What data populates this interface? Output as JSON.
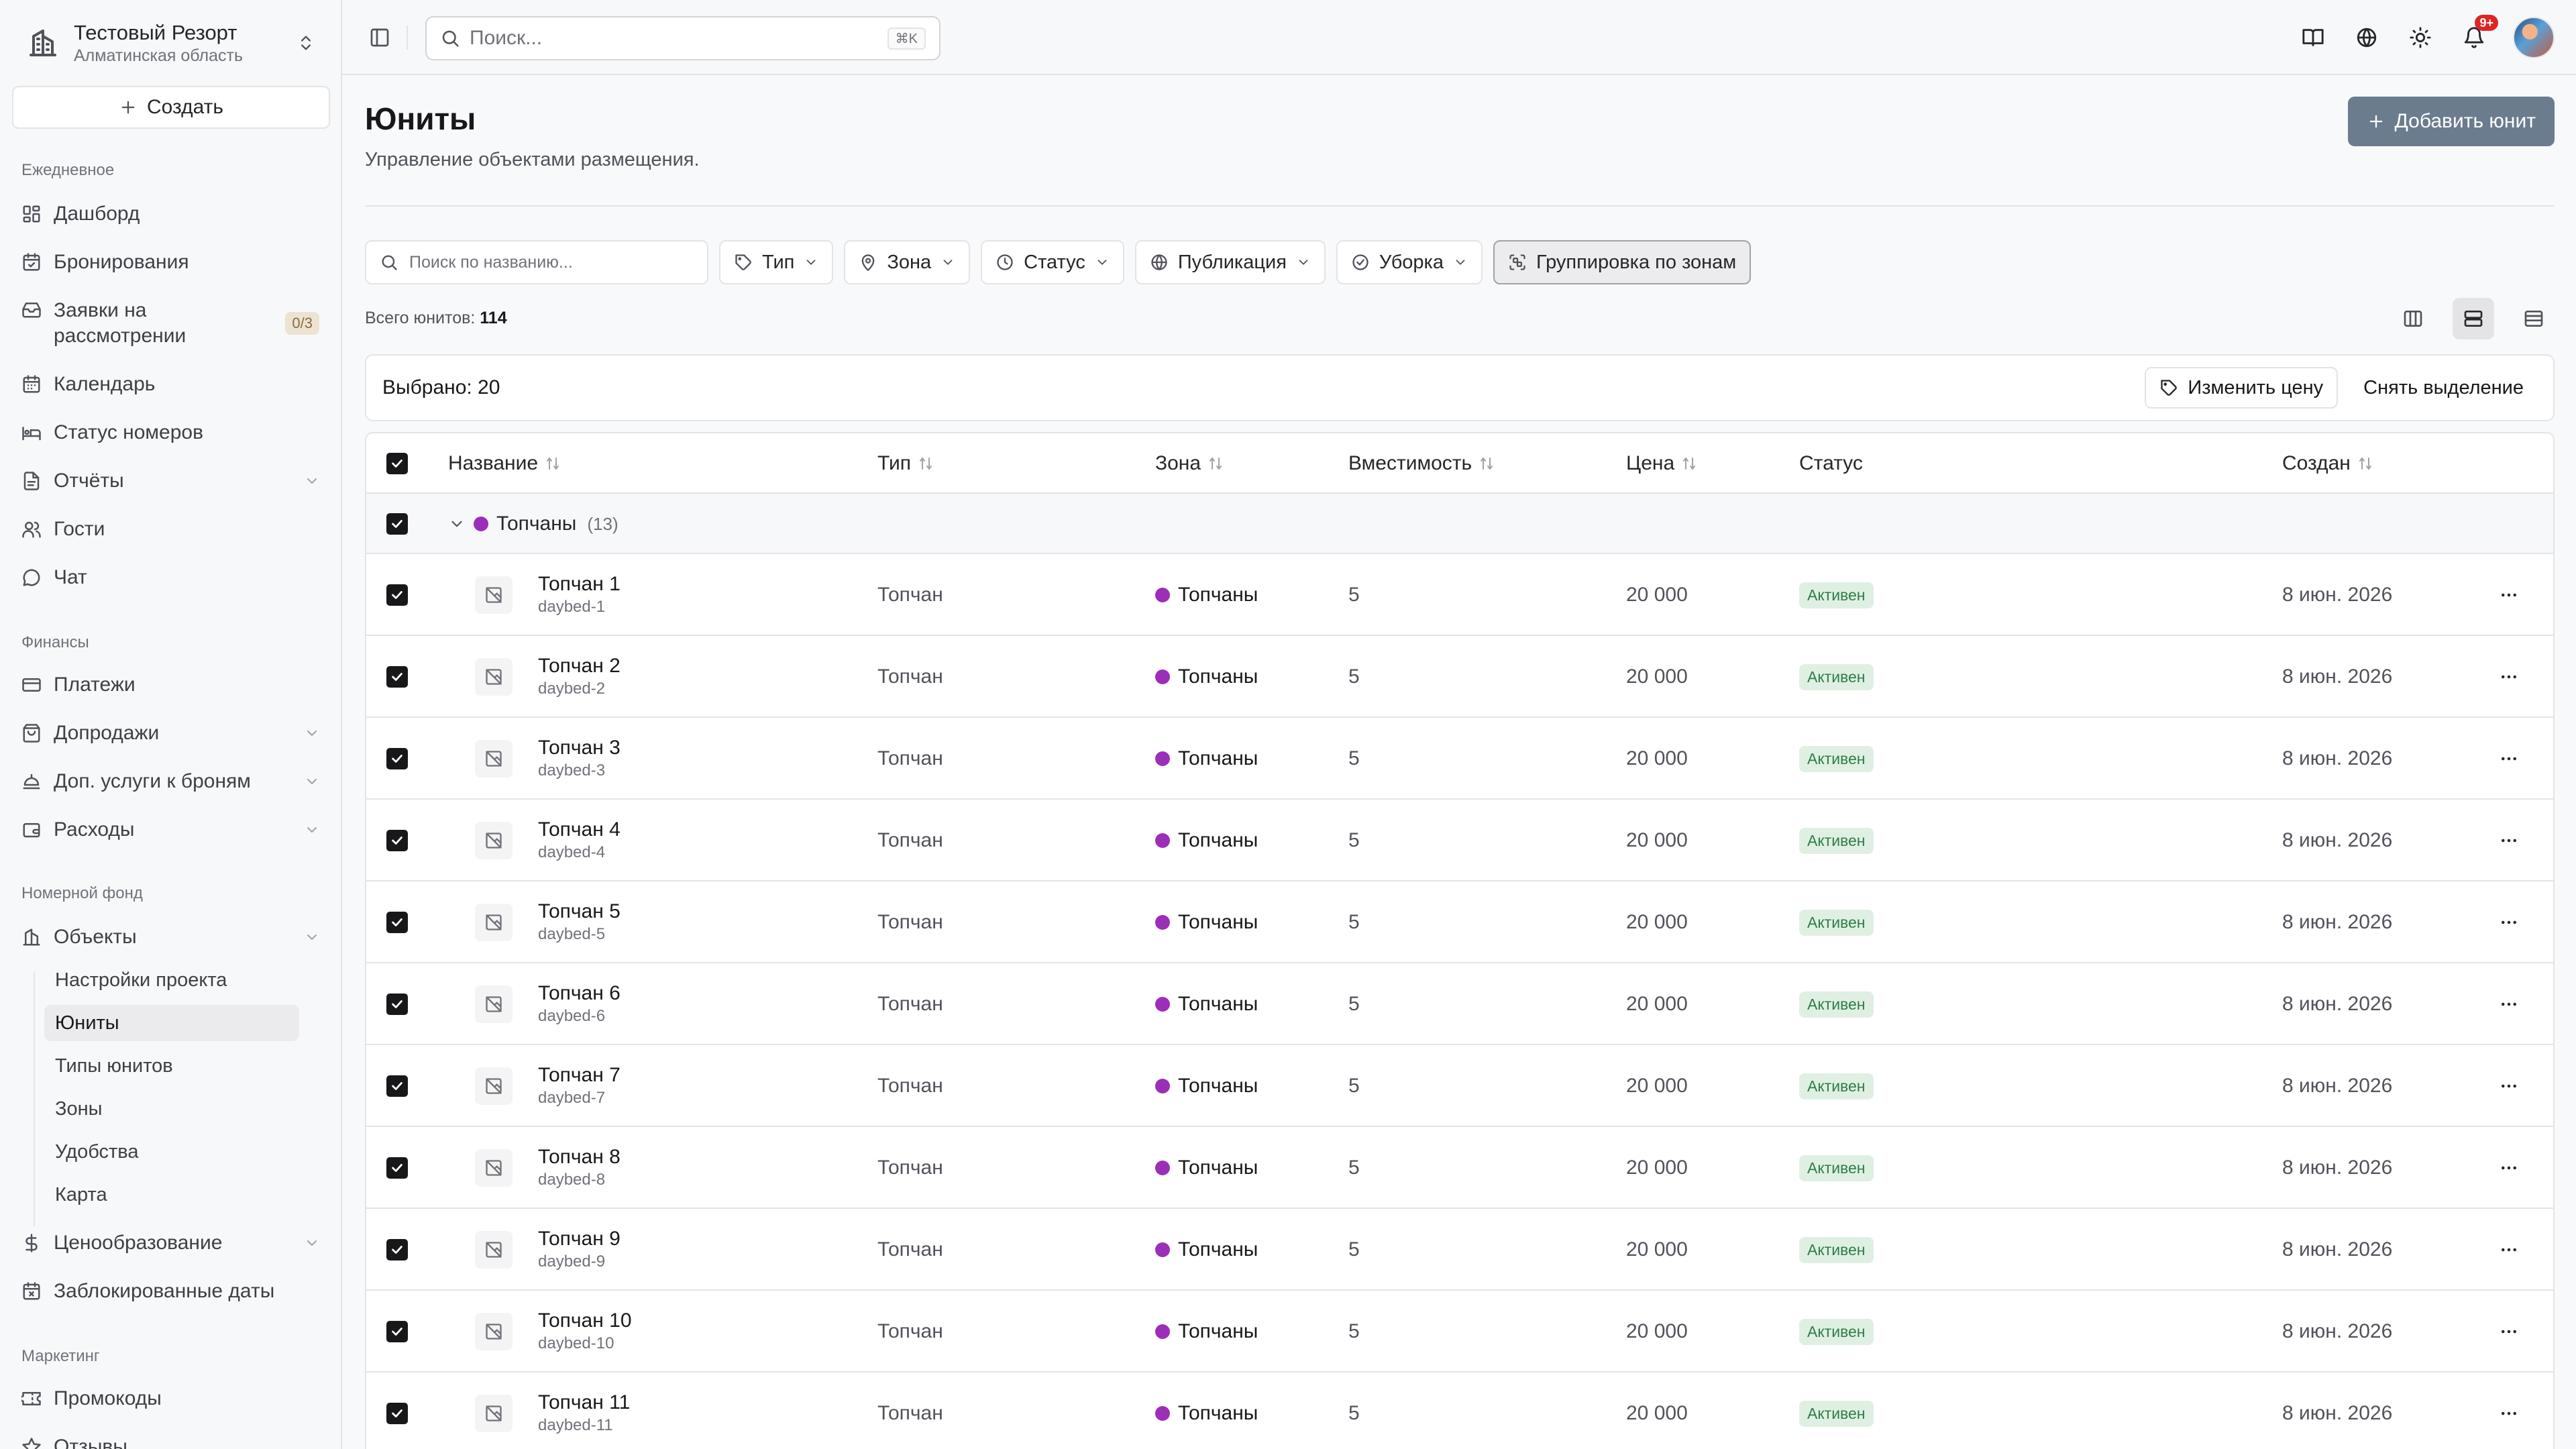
{
  "org": {
    "name": "Тестовый Резорт",
    "region": "Алматинская область"
  },
  "sidebar": {
    "create_label": "Создать",
    "sections": {
      "daily": "Ежедневное",
      "finance": "Финансы",
      "rooms": "Номерной фонд",
      "marketing": "Маркетинг"
    },
    "items": {
      "dashboard": "Дашборд",
      "bookings": "Бронирования",
      "requests": "Заявки на рассмотрении",
      "requests_badge": "0/3",
      "calendar": "Календарь",
      "room_status": "Статус номеров",
      "reports": "Отчёты",
      "guests": "Гости",
      "chat": "Чат",
      "payments": "Платежи",
      "upsells": "Допродажи",
      "extras": "Доп. услуги к броням",
      "expenses": "Расходы",
      "objects": "Объекты",
      "pricing": "Ценообразование",
      "blocked_dates": "Заблокированные даты",
      "promocodes": "Промокоды",
      "reviews": "Отзывы"
    },
    "objects_sub": {
      "project_settings": "Настройки проекта",
      "units": "Юниты",
      "unit_types": "Типы юнитов",
      "zones": "Зоны",
      "amenities": "Удобства",
      "map": "Карта"
    }
  },
  "topbar": {
    "search_placeholder": "Поиск...",
    "shortcut": "⌘K",
    "notifications_badge": "9+"
  },
  "page": {
    "title": "Юниты",
    "subtitle": "Управление объектами размещения.",
    "add_button": "Добавить юнит"
  },
  "filters": {
    "search_placeholder": "Поиск по названию...",
    "type": "Тип",
    "zone": "Зона",
    "status": "Статус",
    "publication": "Публикация",
    "cleaning": "Уборка",
    "group_by_zone": "Группировка по зонам"
  },
  "summary": {
    "total_label": "Всего юнитов:",
    "total_value": "114"
  },
  "selection": {
    "text": "Выбрано: 20",
    "change_price": "Изменить цену",
    "clear": "Снять выделение"
  },
  "table": {
    "columns": {
      "name": "Название",
      "type": "Тип",
      "zone": "Зона",
      "capacity": "Вместимость",
      "price": "Цена",
      "status": "Статус",
      "created": "Создан"
    },
    "group": {
      "name": "Топчаны",
      "count": "(13)",
      "color": "#9c2fb8"
    },
    "rows": [
      {
        "name": "Топчан 1",
        "slug": "daybed-1",
        "type": "Топчан",
        "zone": "Топчаны",
        "capacity": "5",
        "price": "20 000",
        "status": "Активен",
        "created": "8 июн. 2026"
      },
      {
        "name": "Топчан 2",
        "slug": "daybed-2",
        "type": "Топчан",
        "zone": "Топчаны",
        "capacity": "5",
        "price": "20 000",
        "status": "Активен",
        "created": "8 июн. 2026"
      },
      {
        "name": "Топчан 3",
        "slug": "daybed-3",
        "type": "Топчан",
        "zone": "Топчаны",
        "capacity": "5",
        "price": "20 000",
        "status": "Активен",
        "created": "8 июн. 2026"
      },
      {
        "name": "Топчан 4",
        "slug": "daybed-4",
        "type": "Топчан",
        "zone": "Топчаны",
        "capacity": "5",
        "price": "20 000",
        "status": "Активен",
        "created": "8 июн. 2026"
      },
      {
        "name": "Топчан 5",
        "slug": "daybed-5",
        "type": "Топчан",
        "zone": "Топчаны",
        "capacity": "5",
        "price": "20 000",
        "status": "Активен",
        "created": "8 июн. 2026"
      },
      {
        "name": "Топчан 6",
        "slug": "daybed-6",
        "type": "Топчан",
        "zone": "Топчаны",
        "capacity": "5",
        "price": "20 000",
        "status": "Активен",
        "created": "8 июн. 2026"
      },
      {
        "name": "Топчан 7",
        "slug": "daybed-7",
        "type": "Топчан",
        "zone": "Топчаны",
        "capacity": "5",
        "price": "20 000",
        "status": "Активен",
        "created": "8 июн. 2026"
      },
      {
        "name": "Топчан 8",
        "slug": "daybed-8",
        "type": "Топчан",
        "zone": "Топчаны",
        "capacity": "5",
        "price": "20 000",
        "status": "Активен",
        "created": "8 июн. 2026"
      },
      {
        "name": "Топчан 9",
        "slug": "daybed-9",
        "type": "Топчан",
        "zone": "Топчаны",
        "capacity": "5",
        "price": "20 000",
        "status": "Активен",
        "created": "8 июн. 2026"
      },
      {
        "name": "Топчан 10",
        "slug": "daybed-10",
        "type": "Топчан",
        "zone": "Топчаны",
        "capacity": "5",
        "price": "20 000",
        "status": "Активен",
        "created": "8 июн. 2026"
      },
      {
        "name": "Топчан 11",
        "slug": "daybed-11",
        "type": "Топчан",
        "zone": "Топчаны",
        "capacity": "5",
        "price": "20 000",
        "status": "Активен",
        "created": "8 июн. 2026"
      }
    ]
  },
  "colors": {
    "accent": "#6b7c8e",
    "zone_purple": "#9c2fb8",
    "status_green": "#2f7d46",
    "notification_red": "#dc2626"
  }
}
